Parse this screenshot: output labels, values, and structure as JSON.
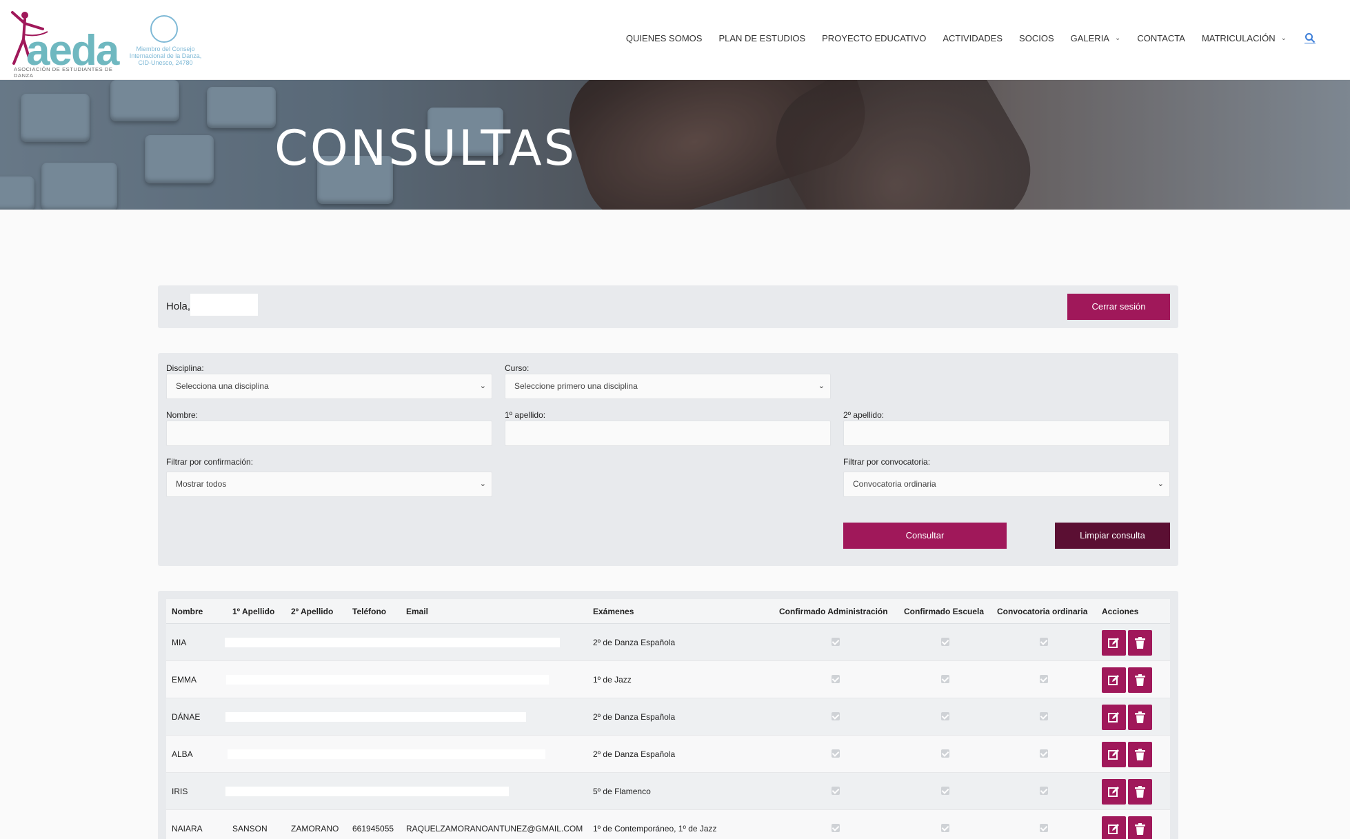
{
  "brand": {
    "logo_text": "aeda",
    "logo_sub": "ASOCIACIÓN DE ESTUDIANTES DE DANZA",
    "cid_text": "Miembro del Consejo Internacional de la Danza, CID-Unesco, 24780",
    "accent": "#a0185a",
    "accent_dark": "#5b0f33"
  },
  "nav": {
    "items": [
      {
        "label": "QUIENES SOMOS"
      },
      {
        "label": "PLAN DE ESTUDIOS"
      },
      {
        "label": "PROYECTO EDUCATIVO"
      },
      {
        "label": "ACTIVIDADES"
      },
      {
        "label": "SOCIOS"
      },
      {
        "label": "GALERIA",
        "dropdown": true
      },
      {
        "label": "CONTACTA"
      },
      {
        "label": "MATRICULACIÓN",
        "dropdown": true
      }
    ],
    "search_icon": "search-icon"
  },
  "hero": {
    "title": "CONSULTAS"
  },
  "greeting": {
    "label": "Hola,",
    "logout_label": "Cerrar sesión"
  },
  "filters": {
    "disciplina_label": "Disciplina:",
    "disciplina_value": "Selecciona una disciplina",
    "curso_label": "Curso:",
    "curso_value": "Seleccione primero una disciplina",
    "nombre_label": "Nombre:",
    "apellido1_label": "1º apellido:",
    "apellido2_label": "2º apellido:",
    "confirmacion_label": "Filtrar por confirmación:",
    "confirmacion_value": "Mostrar todos",
    "convocatoria_label": "Filtrar por convocatoria:",
    "convocatoria_value": "Convocatoria ordinaria",
    "consult_label": "Consultar",
    "clear_label": "Limpiar consulta"
  },
  "table": {
    "headers": {
      "nombre": "Nombre",
      "apellido1": "1º Apellido",
      "apellido2": "2º Apellido",
      "telefono": "Teléfono",
      "email": "Email",
      "examenes": "Exámenes",
      "conf_admin": "Confirmado Administración",
      "conf_escuela": "Confirmado Escuela",
      "convocatoria": "Convocatoria ordinaria",
      "acciones": "Acciones"
    },
    "rows": [
      {
        "nombre": "MIA",
        "apellido1": "",
        "apellido2": "",
        "telefono": "",
        "email": "",
        "examenes": "2º de Danza Española",
        "conf_admin": true,
        "conf_escuela": true,
        "convocatoria": true
      },
      {
        "nombre": "EMMA",
        "apellido1": "",
        "apellido2": "",
        "telefono": "",
        "email": "",
        "examenes": "1º de Jazz",
        "conf_admin": true,
        "conf_escuela": true,
        "convocatoria": true
      },
      {
        "nombre": "DÁNAE",
        "apellido1": "",
        "apellido2": "",
        "telefono": "",
        "email": "",
        "examenes": "2º de Danza Española",
        "conf_admin": true,
        "conf_escuela": true,
        "convocatoria": true
      },
      {
        "nombre": "ALBA",
        "apellido1": "",
        "apellido2": "",
        "telefono": "",
        "email": "",
        "examenes": "2º de Danza Española",
        "conf_admin": true,
        "conf_escuela": true,
        "convocatoria": true
      },
      {
        "nombre": "IRIS",
        "apellido1": "",
        "apellido2": "",
        "telefono": "",
        "email": "",
        "examenes": "5º de Flamenco",
        "conf_admin": true,
        "conf_escuela": true,
        "convocatoria": true
      },
      {
        "nombre": "NAIARA",
        "apellido1": "SANSON",
        "apellido2": "ZAMORANO",
        "telefono": "661945055",
        "email": "RAQUELZAMORANOANTUNEZ@GMAIL.COM",
        "examenes": "1º de Contemporáneo, 1º de Jazz",
        "conf_admin": true,
        "conf_escuela": true,
        "convocatoria": true
      }
    ],
    "edit_icon": "edit-icon",
    "delete_icon": "trash-icon"
  }
}
